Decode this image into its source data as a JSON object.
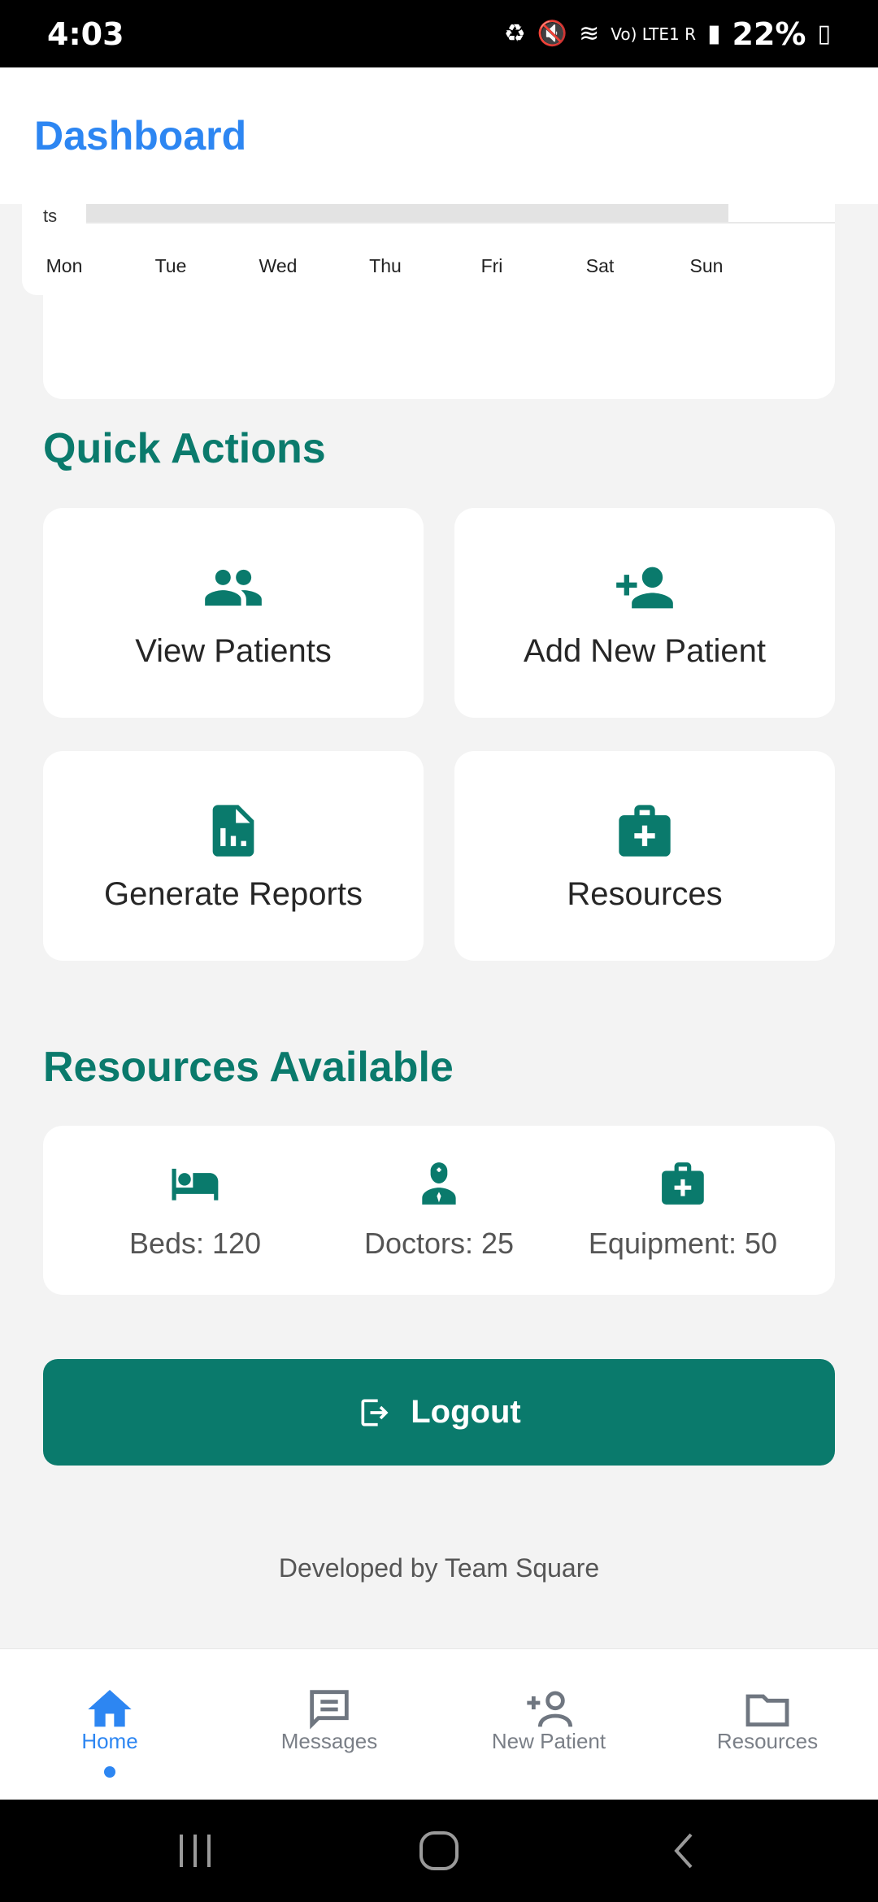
{
  "status_bar": {
    "time": "4:03",
    "battery": "22%",
    "network_label": "Vo) LTE1 R"
  },
  "header": {
    "title": "Dashboard"
  },
  "weekly_chart": {
    "truncated_label": "ts",
    "days": [
      "Mon",
      "Tue",
      "Wed",
      "Thu",
      "Fri",
      "Sat",
      "Sun"
    ]
  },
  "quick_actions": {
    "title": "Quick Actions",
    "items": [
      {
        "label": "View Patients",
        "icon": "group-icon"
      },
      {
        "label": "Add New Patient",
        "icon": "person-add-icon"
      },
      {
        "label": "Generate Reports",
        "icon": "report-icon"
      },
      {
        "label": "Resources",
        "icon": "medical-bag-icon"
      }
    ]
  },
  "resources_available": {
    "title": "Resources Available",
    "items": [
      {
        "label": "Beds: 120",
        "icon": "bed-icon"
      },
      {
        "label": "Doctors: 25",
        "icon": "doctor-icon"
      },
      {
        "label": "Equipment: 50",
        "icon": "medical-bag-icon"
      }
    ]
  },
  "logout": {
    "label": "Logout",
    "icon": "logout-icon"
  },
  "footer": {
    "text": "Developed by Team Square"
  },
  "bottom_nav": {
    "items": [
      {
        "label": "Home",
        "icon": "home-icon",
        "active": true
      },
      {
        "label": "Messages",
        "icon": "message-icon",
        "active": false
      },
      {
        "label": "New Patient",
        "icon": "person-add-icon",
        "active": false
      },
      {
        "label": "Resources",
        "icon": "folder-icon",
        "active": false
      }
    ]
  },
  "colors": {
    "primary_teal": "#0a7a6c",
    "accent_blue": "#2d86f2",
    "background": "#f3f3f3"
  }
}
